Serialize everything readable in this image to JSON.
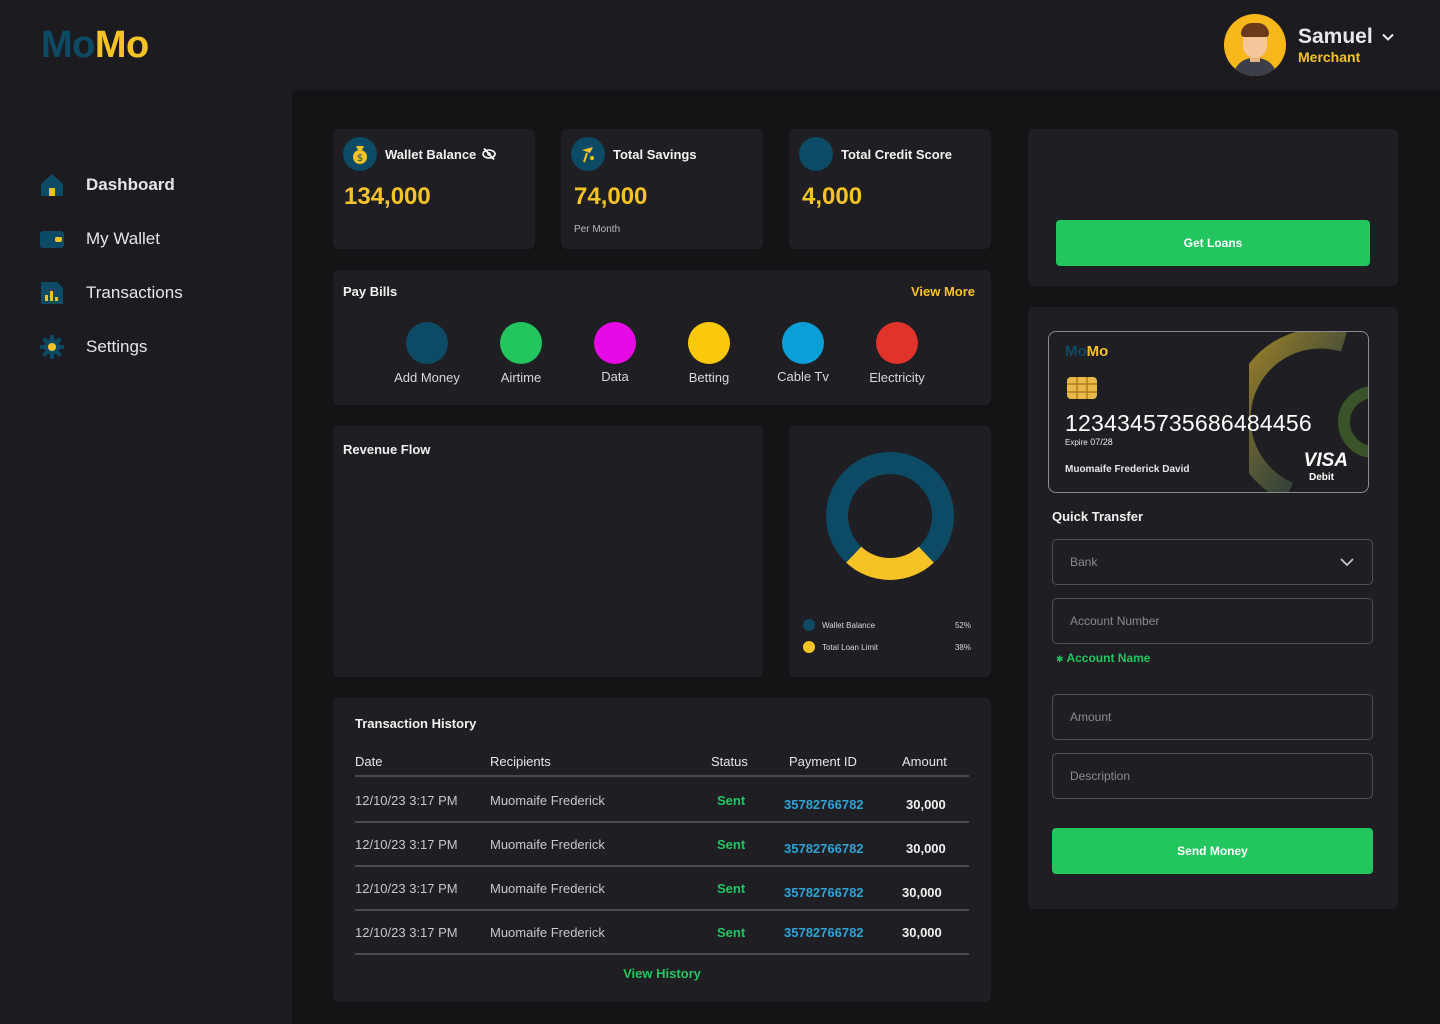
{
  "app": {
    "logo_part1": "Mo",
    "logo_part2": "Mo"
  },
  "user": {
    "name": "Samuel",
    "role": "Merchant"
  },
  "sidebar": {
    "items": [
      {
        "label": "Dashboard",
        "icon": "home-icon",
        "active": true
      },
      {
        "label": "My Wallet",
        "icon": "wallet-icon",
        "active": false
      },
      {
        "label": "Transactions",
        "icon": "transactions-icon",
        "active": false
      },
      {
        "label": "Settings",
        "icon": "gear-icon",
        "active": false
      }
    ]
  },
  "stats": {
    "wallet": {
      "title": "Wallet Balance",
      "value": "134,000"
    },
    "savings": {
      "title": "Total Savings",
      "value": "74,000",
      "sub": "Per Month"
    },
    "credit": {
      "title": "Total Credit Score",
      "value": "4,000"
    }
  },
  "bills": {
    "title": "Pay Bills",
    "more": "View More",
    "items": [
      {
        "label": "Add Money",
        "color": "#0d4a66"
      },
      {
        "label": "Airtime",
        "color": "#22c55e"
      },
      {
        "label": "Data",
        "color": "#e60ae6"
      },
      {
        "label": "Betting",
        "color": "#fcc80a"
      },
      {
        "label": "Cable Tv",
        "color": "#0b9fd8"
      },
      {
        "label": "Electricity",
        "color": "#e2332a"
      }
    ]
  },
  "revenue": {
    "title": "Revenue Flow"
  },
  "donut": {
    "legend": [
      {
        "name": "Wallet Balance",
        "pct": "52%",
        "value": 0.76,
        "color": "#0d4a66"
      },
      {
        "name": "Total Loan Limit",
        "pct": "38%",
        "value": 0.24,
        "color": "#f6c327"
      }
    ]
  },
  "history": {
    "title": "Transaction History",
    "columns": [
      "Date",
      "Recipients",
      "Status",
      "Payment ID",
      "Amount"
    ],
    "rows": [
      {
        "date": "12/10/23  3:17 PM",
        "recipient": "Muomaife Frederick",
        "status": "Sent",
        "pid": "35782766782",
        "amount": "30,000"
      },
      {
        "date": "12/10/23  3:17 PM",
        "recipient": "Muomaife Frederick",
        "status": "Sent",
        "pid": "35782766782",
        "amount": "30,000"
      },
      {
        "date": "12/10/23  3:17 PM",
        "recipient": "Muomaife Frederick",
        "status": "Sent",
        "pid": "35782766782",
        "amount": "30,000"
      },
      {
        "date": "12/10/23  3:17 PM",
        "recipient": "Muomaife Frederick",
        "status": "Sent",
        "pid": "35782766782",
        "amount": "30,000"
      }
    ],
    "view_all": "View History"
  },
  "loans": {
    "button": "Get Loans"
  },
  "card": {
    "brand1": "Mo",
    "brand2": "Mo",
    "number": "1234345735686484456",
    "expire_label": "Expire",
    "expire": "07/28",
    "holder": "Muomaife Frederick David",
    "network": "VISA",
    "type": "Debit"
  },
  "transfer": {
    "title": "Quick Transfer",
    "bank_placeholder": "Bank",
    "account_placeholder": "Account Number",
    "account_name": "Account Name",
    "amount_placeholder": "Amount",
    "description_placeholder": "Description",
    "send": "Send Money"
  },
  "colors": {
    "accent": "#f6c327",
    "green": "#22c55e",
    "navy": "#0d4a66",
    "link": "#2fa3d6"
  }
}
